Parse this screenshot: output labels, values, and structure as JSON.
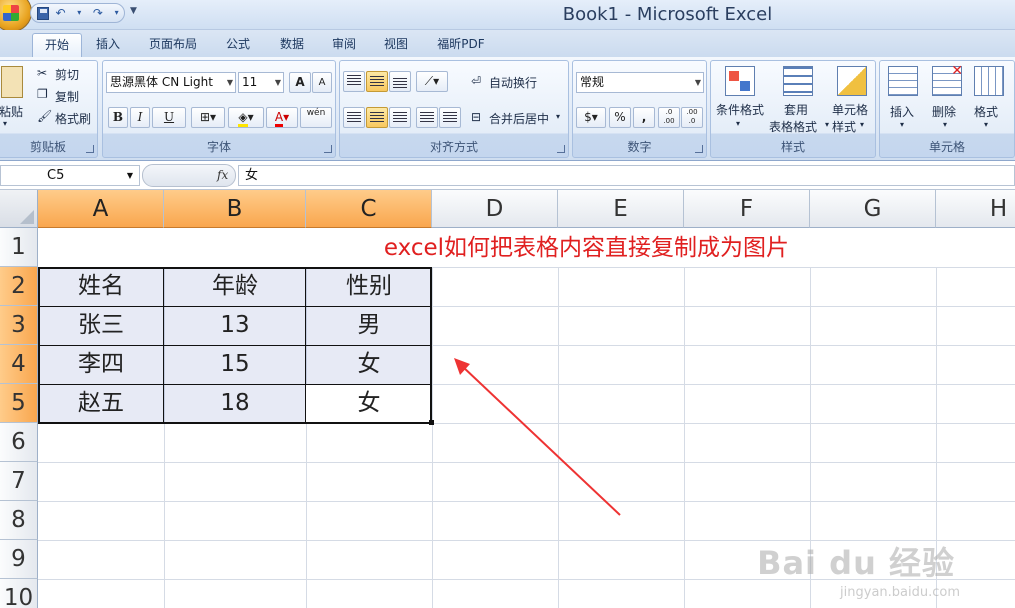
{
  "window": {
    "title": "Book1 - Microsoft Excel"
  },
  "tabs": [
    "开始",
    "插入",
    "页面布局",
    "公式",
    "数据",
    "审阅",
    "视图",
    "福昕PDF"
  ],
  "ribbon": {
    "clipboard": {
      "paste": "粘贴",
      "cut": "剪切",
      "copy": "复制",
      "format_painter": "格式刷",
      "label": "剪贴板"
    },
    "font": {
      "name": "思源黑体 CN Light",
      "size": "11",
      "bold": "B",
      "italic": "I",
      "underline": "U",
      "grow": "A",
      "shrink": "A",
      "font_color": "A",
      "phonetic": "wén",
      "label": "字体"
    },
    "alignment": {
      "wrap": "自动换行",
      "merge": "合并后居中",
      "label": "对齐方式"
    },
    "number": {
      "format": "常规",
      "percent": "%",
      "comma": ",",
      "inc_decimal": ".0 .00",
      "dec_decimal": ".00 .0",
      "label": "数字"
    },
    "styles": {
      "conditional": "条件格式",
      "table_format_1": "套用",
      "table_format_2": "表格格式",
      "cell_styles_1": "单元格",
      "cell_styles_2": "样式",
      "label": "样式"
    },
    "cells": {
      "insert": "插入",
      "delete": "删除",
      "format": "格式",
      "label": "单元格"
    }
  },
  "formula_bar": {
    "name_box": "C5",
    "fx": "fx",
    "value": "女"
  },
  "grid": {
    "columns": [
      "A",
      "B",
      "C",
      "D",
      "E",
      "F",
      "G",
      "H"
    ],
    "rows": [
      "1",
      "2",
      "3",
      "4",
      "5",
      "6",
      "7",
      "8",
      "9",
      "10"
    ],
    "title": "excel如何把表格内容直接复制成为图片",
    "table": {
      "headers": [
        "姓名",
        "年龄",
        "性别"
      ],
      "rows": [
        [
          "张三",
          "13",
          "男"
        ],
        [
          "李四",
          "15",
          "女"
        ],
        [
          "赵五",
          "18",
          "女"
        ]
      ]
    }
  },
  "watermark": {
    "main": "Bai du 经验",
    "sub": "jingyan.baidu.com"
  },
  "colors": {
    "title_red": "#e02020",
    "arrow_red": "#e33",
    "header_selected": "#f9a64e",
    "selection": "#dfe3f0"
  }
}
